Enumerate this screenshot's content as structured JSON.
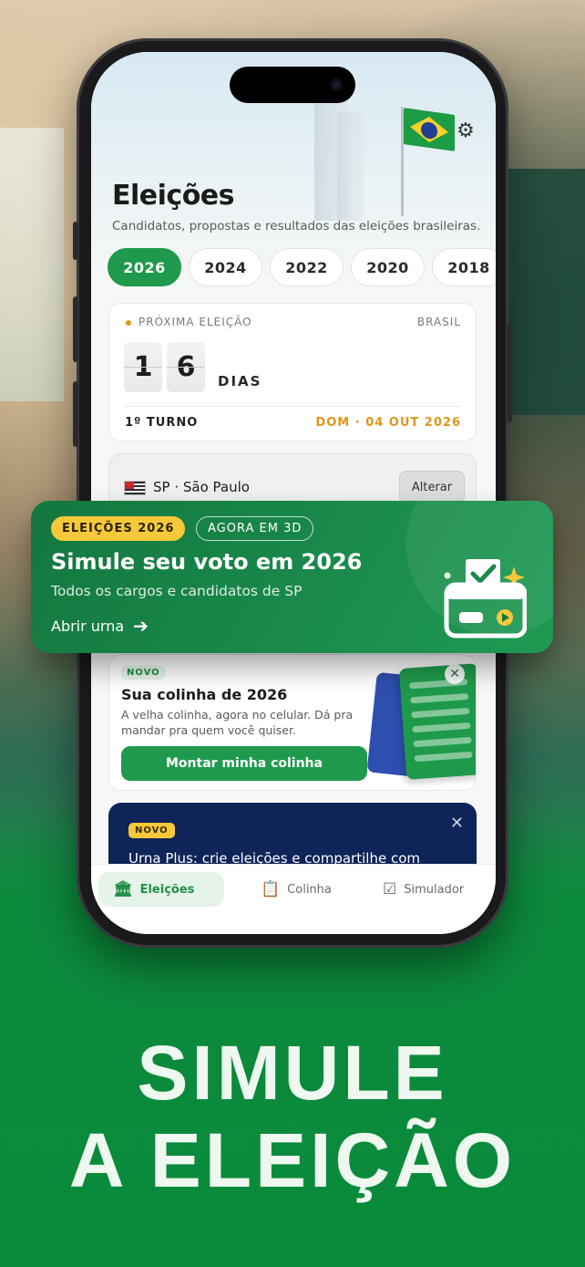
{
  "header": {
    "title": "Eleições",
    "subtitle": "Candidatos, propostas e resultados das eleições brasileiras.",
    "settings_icon": "gear-icon"
  },
  "years": [
    "2026",
    "2024",
    "2022",
    "2020",
    "2018"
  ],
  "selected_year": "2026",
  "next_election": {
    "label": "PRÓXIMA ELEIÇÃO",
    "region": "BRASIL",
    "days_digits": [
      "1",
      "6"
    ],
    "days_label": "DIAS",
    "round": "1º TURNO",
    "date": "DOM · 04 OUT 2026"
  },
  "state": {
    "name": "SP · São Paulo",
    "change_label": "Alterar"
  },
  "banner": {
    "tag": "ELEIÇÕES 2026",
    "tag_3d": "AGORA EM 3D",
    "title": "Simule seu voto em 2026",
    "subtitle": "Todos os cargos e candidatos de SP",
    "link": "Abrir urna",
    "accent": "#f6c93a"
  },
  "colinha": {
    "badge": "NOVO",
    "title": "Sua colinha de 2026",
    "description": "A velha colinha, agora no celular. Dá pra mandar pra quem você quiser.",
    "button": "Montar minha colinha"
  },
  "urna_plus": {
    "badge": "NOVO",
    "title": "Urna Plus: crie eleições e compartilhe com"
  },
  "tabs": [
    {
      "label": "Eleições",
      "icon": "institution-icon"
    },
    {
      "label": "Colinha",
      "icon": "clipboard-icon"
    },
    {
      "label": "Simulador",
      "icon": "ballot-check-icon"
    }
  ],
  "headline": {
    "line1": "SIMULE",
    "line2": "A ELEIÇÃO"
  },
  "colors": {
    "brand_green": "#1f9a4c",
    "accent_orange": "#e0961b",
    "navy": "#0f2458"
  }
}
